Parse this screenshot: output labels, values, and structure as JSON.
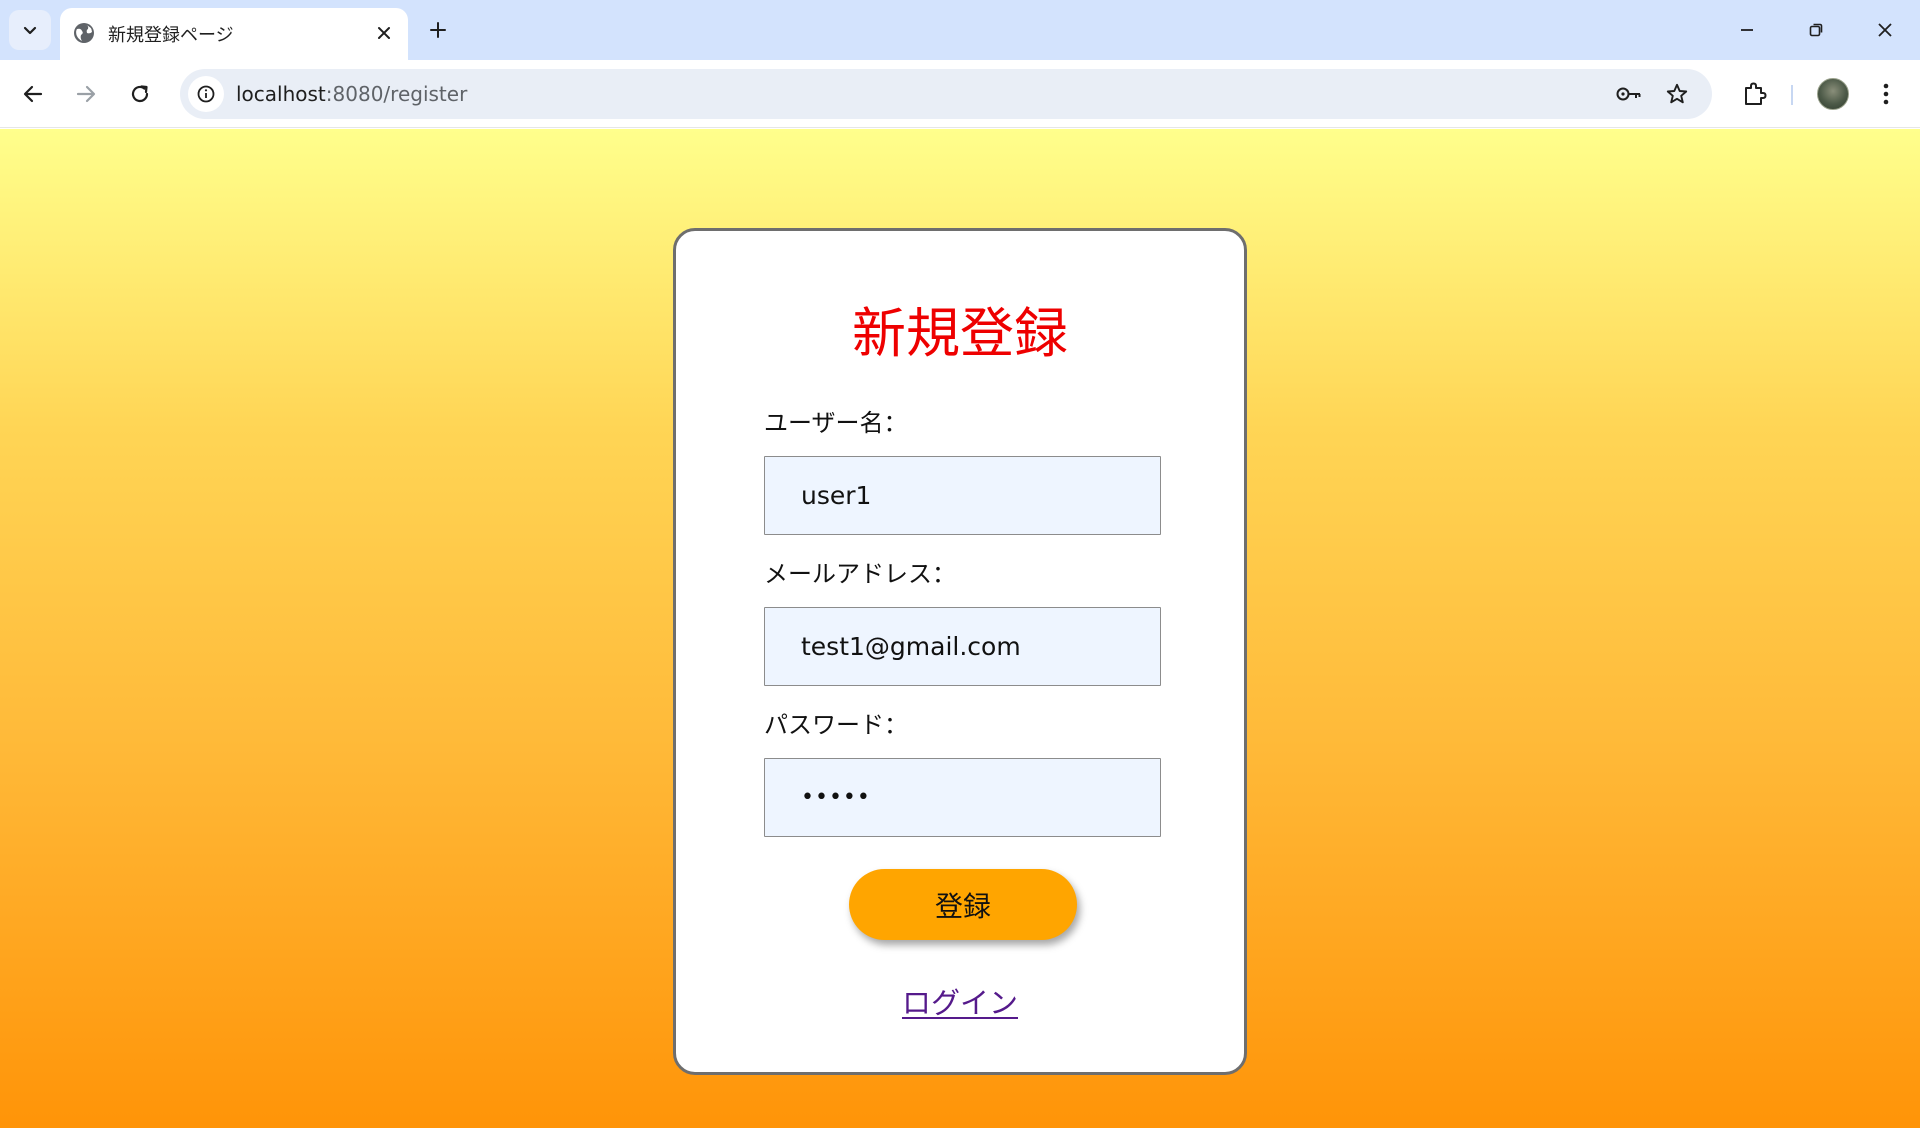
{
  "browser": {
    "tab_title": "新規登録ページ",
    "url_host": "localhost",
    "url_rest": ":8080/register"
  },
  "form": {
    "title": "新規登録",
    "username_label": "ユーザー名：",
    "username_value": "user1",
    "email_label": "メールアドレス：",
    "email_value": "test1@gmail.com",
    "password_label": "パスワード：",
    "password_value": "•••••",
    "submit_label": "登録",
    "login_link": "ログイン"
  },
  "colors": {
    "title": "#ee0000",
    "button": "#ffa500",
    "input_bg": "#eef5ff",
    "gradient_top": "#ffff8c",
    "gradient_bottom": "#ff9408"
  }
}
